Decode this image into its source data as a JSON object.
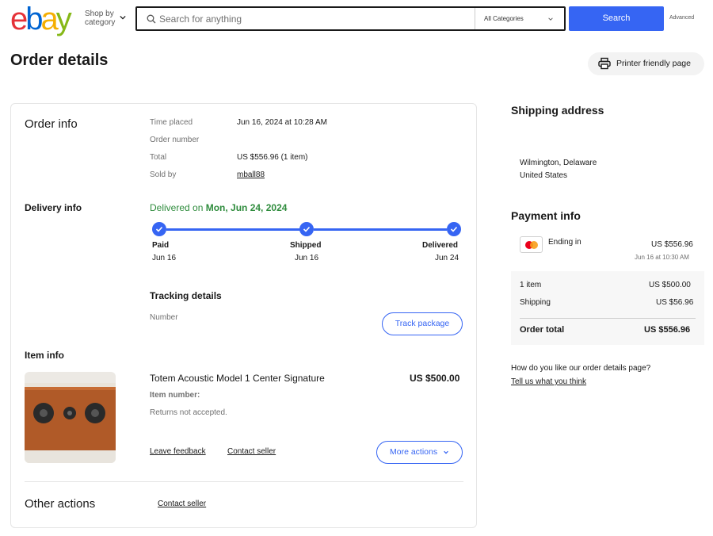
{
  "header": {
    "logo": "ebay",
    "shop_by": "Shop by",
    "category": "category",
    "search_placeholder": "Search for anything",
    "category_select": "All Categories",
    "search_button": "Search",
    "advanced": "Advanced"
  },
  "page": {
    "title": "Order details",
    "print_button": "Printer friendly page"
  },
  "order_info": {
    "heading": "Order info",
    "time_placed_label": "Time placed",
    "time_placed_value": "Jun 16, 2024 at 10:28 AM",
    "order_number_label": "Order number",
    "total_label": "Total",
    "total_value": "US $556.96 (1 item)",
    "sold_by_label": "Sold by",
    "sold_by_value": "mball88"
  },
  "delivery_info": {
    "heading": "Delivery info",
    "status_prefix": "Delivered on",
    "status_date": "Mon, Jun 24, 2024",
    "steps": [
      {
        "name": "Paid",
        "date": "Jun 16"
      },
      {
        "name": "Shipped",
        "date": "Jun 16"
      },
      {
        "name": "Delivered",
        "date": "Jun 24"
      }
    ],
    "tracking_heading": "Tracking details",
    "number_label": "Number",
    "track_button": "Track package"
  },
  "item_info": {
    "heading": "Item info",
    "title": "Totem Acoustic Model 1 Center Signature",
    "price": "US $500.00",
    "item_number_label": "Item number:",
    "returns": "Returns not accepted.",
    "leave_feedback": "Leave feedback",
    "contact_seller": "Contact seller",
    "more_actions": "More actions"
  },
  "other_actions": {
    "heading": "Other actions",
    "contact_seller": "Contact seller"
  },
  "shipping_address": {
    "heading": "Shipping address",
    "city_state": "Wilmington, Delaware",
    "country": "United States"
  },
  "payment_info": {
    "heading": "Payment info",
    "card_label": "Ending in",
    "card_amount": "US $556.96",
    "card_date": "Jun 16 at 10:30 AM",
    "items_label": "1 item",
    "items_value": "US $500.00",
    "shipping_label": "Shipping",
    "shipping_value": "US $56.96",
    "total_label": "Order total",
    "total_value": "US $556.96"
  },
  "feedback": {
    "question": "How do you like our order details page?",
    "link": "Tell us what you think"
  },
  "colors": {
    "brand_blue": "#3665f3",
    "delivered_green": "#2f8c3d"
  }
}
